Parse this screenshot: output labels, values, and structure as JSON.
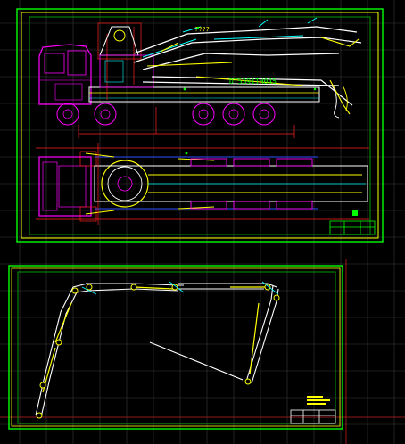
{
  "drawing": {
    "top_sheet": {
      "label_model": "DT5391TH045",
      "label_question": "????",
      "colors": {
        "frame_outer": "#00ff00",
        "frame_inner": "#ffff00",
        "truck": "#ff00ff",
        "boom": "#ffffff",
        "hydraulics": "#ffff00",
        "dimensions": "#ff0000",
        "hatch": "#00ffff",
        "outline": "#00c000",
        "blue": "#3050ff"
      }
    },
    "bottom_sheet": {
      "colors": {
        "frame_outer": "#00ff00",
        "frame_inner": "#ffffff",
        "boom": "#ffffff",
        "joints": "#ffff00",
        "cylinders": "#ffff00"
      }
    },
    "background": "#000000",
    "grid_color": "#333333",
    "crosshair_color": "#c02020"
  }
}
